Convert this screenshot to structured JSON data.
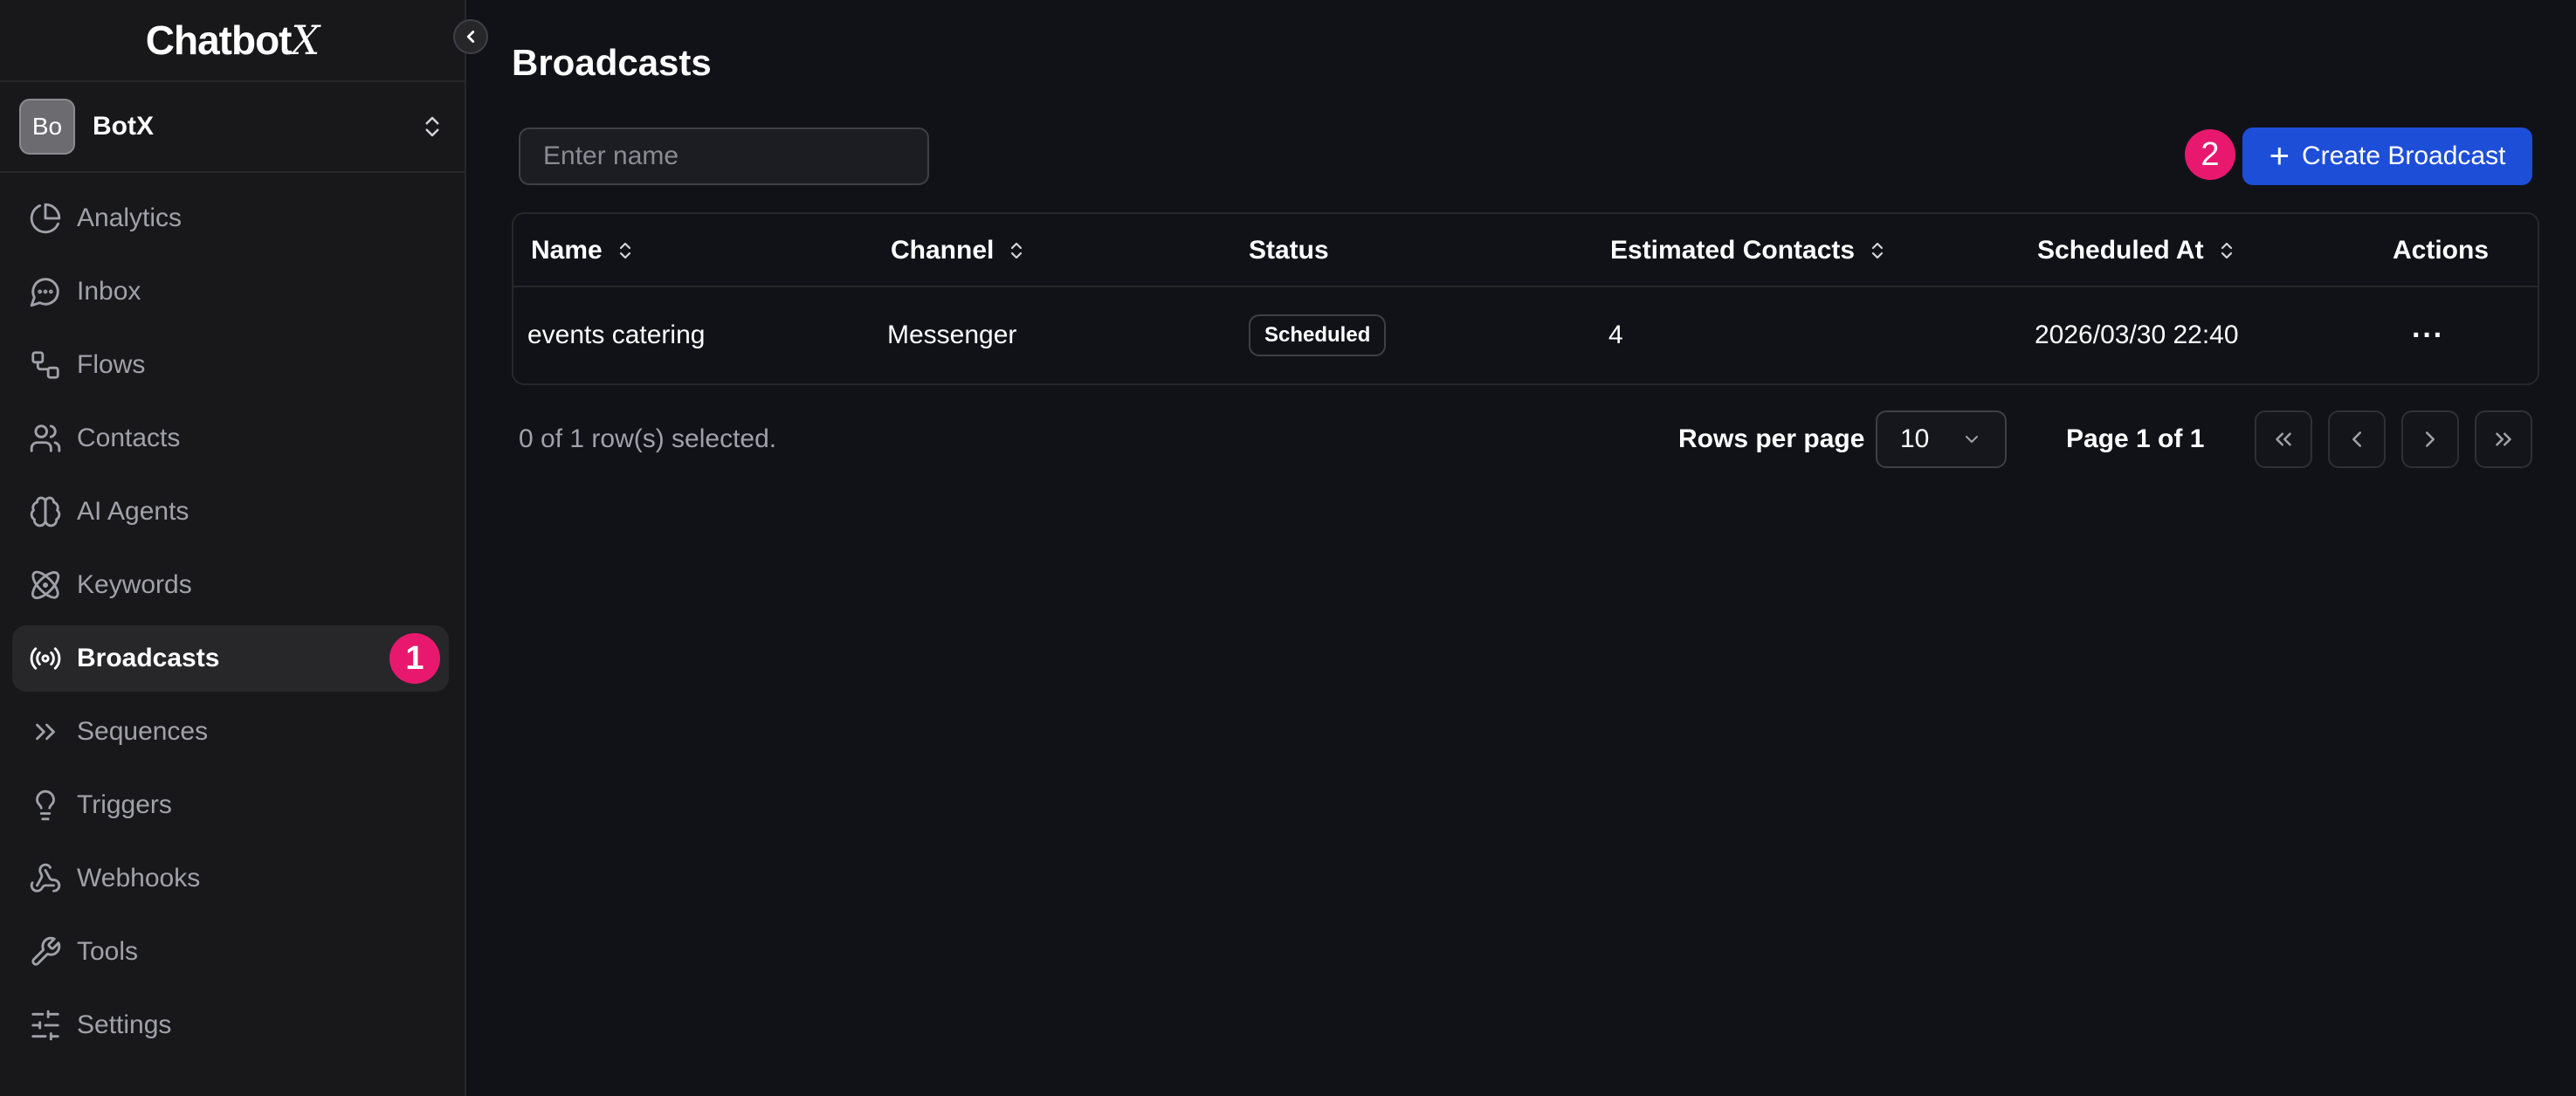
{
  "brand": {
    "name_main": "Chatbot",
    "name_x": "X"
  },
  "workspace": {
    "initials": "Bo",
    "name": "BotX"
  },
  "sidebar": {
    "items": [
      {
        "label": "Analytics",
        "icon": "pie-chart-icon"
      },
      {
        "label": "Inbox",
        "icon": "message-circle-icon"
      },
      {
        "label": "Flows",
        "icon": "flow-icon"
      },
      {
        "label": "Contacts",
        "icon": "users-icon"
      },
      {
        "label": "AI Agents",
        "icon": "brain-icon"
      },
      {
        "label": "Keywords",
        "icon": "atom-icon"
      },
      {
        "label": "Broadcasts",
        "icon": "radio-icon",
        "active": true,
        "marker": "1"
      },
      {
        "label": "Sequences",
        "icon": "chevrons-right-icon"
      },
      {
        "label": "Triggers",
        "icon": "lightbulb-icon"
      },
      {
        "label": "Webhooks",
        "icon": "webhook-icon"
      },
      {
        "label": "Tools",
        "icon": "wrench-icon"
      },
      {
        "label": "Settings",
        "icon": "sliders-icon"
      }
    ]
  },
  "main": {
    "title": "Broadcasts",
    "search": {
      "placeholder": "Enter name",
      "value": ""
    },
    "create_button": {
      "label": "Create Broadcast",
      "marker": "2"
    },
    "table": {
      "columns": [
        "Name",
        "Channel",
        "Status",
        "Estimated Contacts",
        "Scheduled At",
        "Actions"
      ],
      "rows": [
        {
          "name": "events catering",
          "channel": "Messenger",
          "status": "Scheduled",
          "estimated_contacts": "4",
          "scheduled_at": "2026/03/30 22:40",
          "actions": "···"
        }
      ]
    },
    "footer": {
      "selection": "0 of 1 row(s) selected.",
      "rows_per_page_label": "Rows per page",
      "rows_per_page_value": "10",
      "page_label": "Page 1 of 1"
    }
  },
  "colors": {
    "accent": "#1d4ed8",
    "marker": "#e8186f",
    "background": "#111218",
    "sidebar": "#18181b"
  }
}
